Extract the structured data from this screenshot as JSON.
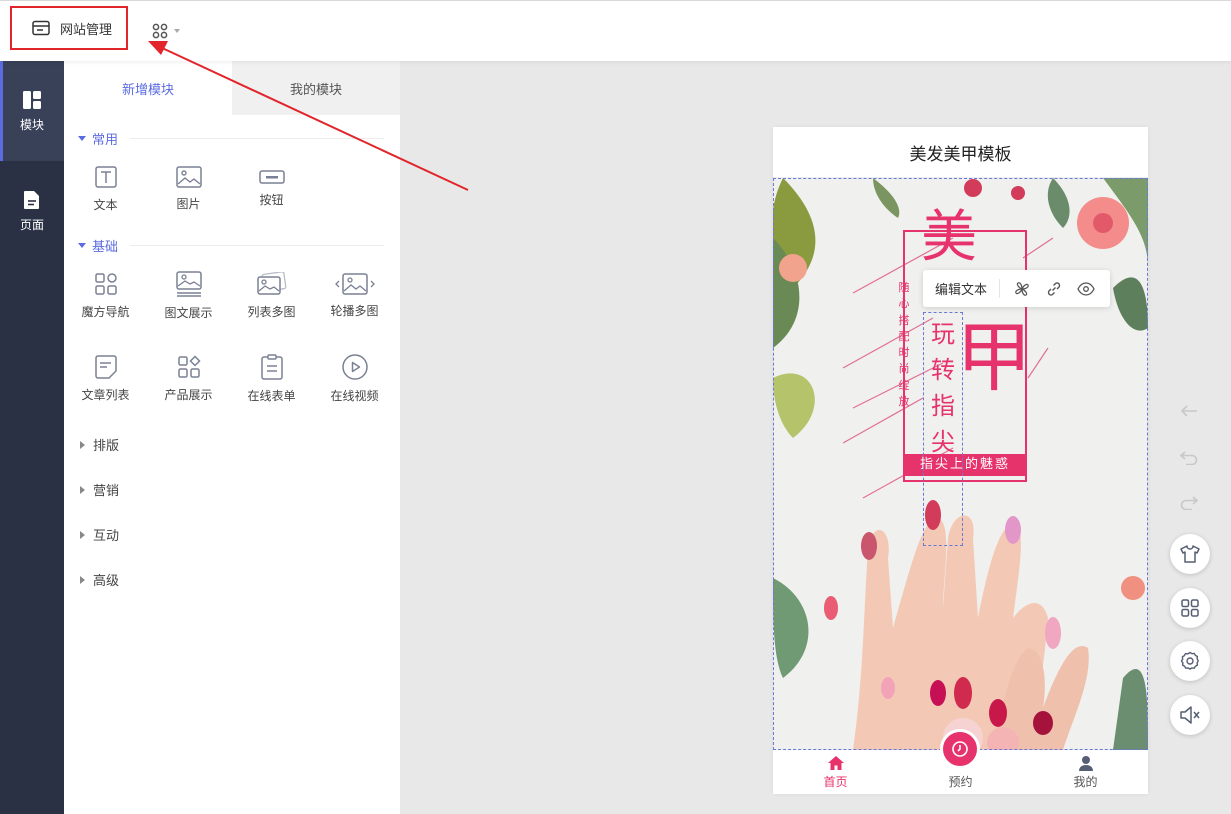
{
  "topbar": {
    "site_manage_label": "网站管理"
  },
  "leftnav": {
    "items": [
      {
        "label": "模块",
        "icon": "layout-icon",
        "active": true
      },
      {
        "label": "页面",
        "icon": "page-icon",
        "active": false
      }
    ]
  },
  "panel": {
    "tabs": [
      {
        "label": "新增模块",
        "active": true
      },
      {
        "label": "我的模块",
        "active": false
      }
    ],
    "sections": {
      "common": {
        "title": "常用",
        "items": [
          {
            "label": "文本",
            "icon": "text-icon"
          },
          {
            "label": "图片",
            "icon": "image-icon"
          },
          {
            "label": "按钮",
            "icon": "button-icon"
          }
        ]
      },
      "basic": {
        "title": "基础",
        "items": [
          {
            "label": "魔方导航",
            "icon": "cube-nav-icon"
          },
          {
            "label": "图文展示",
            "icon": "image-text-icon"
          },
          {
            "label": "列表多图",
            "icon": "list-images-icon"
          },
          {
            "label": "轮播多图",
            "icon": "carousel-icon"
          },
          {
            "label": "文章列表",
            "icon": "article-list-icon"
          },
          {
            "label": "产品展示",
            "icon": "product-icon"
          },
          {
            "label": "在线表单",
            "icon": "form-icon"
          },
          {
            "label": "在线视频",
            "icon": "video-icon"
          }
        ]
      },
      "collapsed": [
        "排版",
        "营销",
        "互动",
        "高级"
      ]
    }
  },
  "phone": {
    "title": "美发美甲模板",
    "banner": {
      "big_char_1": "美",
      "big_char_2": "甲",
      "vertical_title": [
        "玩",
        "转",
        "指",
        "尖"
      ],
      "small_vertical": [
        "随",
        "心",
        "搭",
        "配",
        "时",
        "尚",
        "绽",
        "放"
      ],
      "ribbon": "指尖上的魅惑"
    },
    "tabbar": [
      {
        "label": "首页",
        "icon": "home-icon",
        "active": true
      },
      {
        "label": "预约",
        "icon": "clock-icon",
        "active": false
      },
      {
        "label": "我的",
        "icon": "user-icon",
        "active": false
      }
    ]
  },
  "edit_toolbar": {
    "edit_text_label": "编辑文本",
    "icons": [
      "fan-icon",
      "link-icon",
      "eye-icon"
    ]
  },
  "colors": {
    "accent": "#5b6be0",
    "dark_nav": "#2a3145",
    "pink": "#e6336b",
    "highlight_red": "#e2252b"
  }
}
